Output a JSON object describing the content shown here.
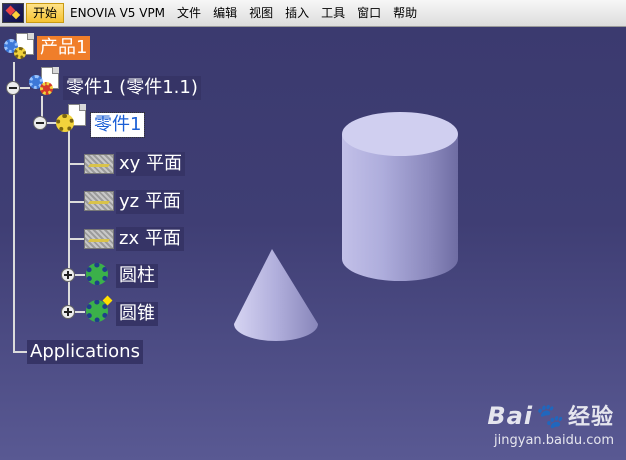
{
  "menu": {
    "items": [
      "开始",
      "ENOVIA V5 VPM",
      "文件",
      "编辑",
      "视图",
      "插入",
      "工具",
      "窗口",
      "帮助"
    ],
    "active_index": 0
  },
  "tree": {
    "root_label": "产品1",
    "part_instance_label": "零件1 (零件1.1)",
    "part_label": "零件1",
    "planes": [
      "xy 平面",
      "yz 平面",
      "zx 平面"
    ],
    "bodies": [
      "圆柱",
      "圆锥"
    ],
    "applications_label": "Applications"
  },
  "watermark": {
    "logo": "Bai",
    "logo_suffix": "经验",
    "url": "jingyan.baidu.com"
  },
  "colors": {
    "viewport_bg": "#3b3a6f",
    "root_highlight": "#f07e2a",
    "selection_text": "#1b5fd6",
    "solid_fill": "#b8b6de"
  },
  "icons": {
    "product": "product-assembly-icon",
    "part_instance": "part-instance-icon",
    "part": "part-gear-icon",
    "plane": "plane-icon",
    "body": "body-gear-icon",
    "toggle_expanded": "minus-toggle-icon",
    "toggle_collapsed": "plus-toggle-icon"
  }
}
